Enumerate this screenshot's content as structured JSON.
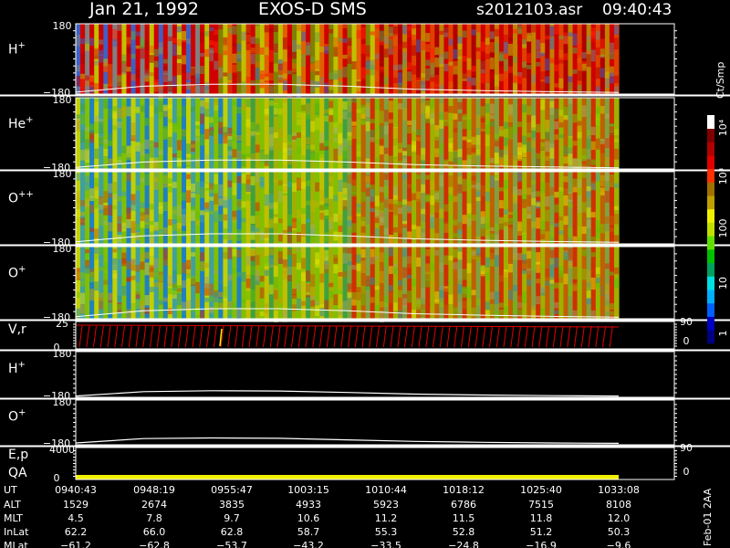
{
  "header": {
    "date": "Jan 21, 1992",
    "instrument": "EXOS-D SMS",
    "file": "s2012103.asr",
    "time": "09:40:43"
  },
  "colorbar": {
    "unit_label": "Ct/Smp",
    "tick_labels": [
      "1",
      "10",
      "100",
      "10³",
      "10⁴"
    ],
    "colors": [
      "#000080",
      "#0000c0",
      "#0060ff",
      "#00b0ff",
      "#00e0e0",
      "#00a060",
      "#00c000",
      "#60e000",
      "#c0e000",
      "#f0f000",
      "#c0a000",
      "#a07000",
      "#ff3000",
      "#e00000",
      "#b00000",
      "#800000",
      "#ffffff"
    ]
  },
  "panels": [
    {
      "id": "h_plus_spec",
      "label": "H",
      "sup": "+",
      "ytop": "180",
      "ybot": "−180"
    },
    {
      "id": "he_plus_spec",
      "label": "He",
      "sup": "+",
      "ytop": "180",
      "ybot": "−180"
    },
    {
      "id": "o_pp_spec",
      "label": "O",
      "sup": "++",
      "ytop": "180",
      "ybot": "−180"
    },
    {
      "id": "o_plus_spec",
      "label": "O",
      "sup": "+",
      "ytop": "180",
      "ybot": "−180"
    },
    {
      "id": "vr",
      "label": "V,r",
      "ytop": "25",
      "ybot": "0",
      "rtop": "90",
      "rbot": "0"
    },
    {
      "id": "h_plus_line",
      "label": "H",
      "sup": "+",
      "ytop": "180",
      "ybot": "−180"
    },
    {
      "id": "o_plus_line",
      "label": "O",
      "sup": "+",
      "ytop": "180",
      "ybot": "−180"
    },
    {
      "id": "ep_qa",
      "label": "E,p",
      "label2": "QA",
      "ytop": "4000",
      "ybot": "0",
      "rtop": "90",
      "rbot": "0"
    }
  ],
  "footer": {
    "row_labels": [
      "UT",
      "ALT",
      "MLT",
      "InLat",
      "MLat"
    ],
    "columns": [
      [
        "0940:43",
        "1529",
        "4.5",
        "62.2",
        "−61.2"
      ],
      [
        "0948:19",
        "2674",
        "7.8",
        "66.0",
        "−62.8"
      ],
      [
        "0955:47",
        "3835",
        "9.7",
        "62.8",
        "−53.7"
      ],
      [
        "1003:15",
        "4933",
        "10.6",
        "58.7",
        "−43.2"
      ],
      [
        "1010:44",
        "5923",
        "11.2",
        "55.3",
        "−33.5"
      ],
      [
        "1018:12",
        "6786",
        "11.5",
        "52.8",
        "−24.8"
      ],
      [
        "1025:40",
        "7515",
        "11.8",
        "51.2",
        "−16.9"
      ],
      [
        "1033:08",
        "8108",
        "12.0",
        "50.3",
        "−9.6"
      ]
    ],
    "stamp": "Feb-01 2AA"
  },
  "chart_data": {
    "type": "heatmap",
    "title": "Jan 21, 1992   EXOS-D SMS",
    "x": [
      "0940:43",
      "0948:19",
      "0955:47",
      "1003:15",
      "1010:44",
      "1018:12",
      "1025:40",
      "1033:08"
    ],
    "ylim": [
      -180,
      180
    ],
    "colorbar_range": [
      1,
      10000
    ],
    "series": [
      {
        "name": "H+",
        "curve": [
          -170,
          -140,
          -130,
          -130,
          -140,
          -155,
          -162,
          -168,
          -172
        ]
      },
      {
        "name": "He+",
        "curve": [
          -172,
          -145,
          -135,
          -135,
          -145,
          -158,
          -165,
          -170,
          -174
        ]
      },
      {
        "name": "O++",
        "curve": [
          -170,
          -140,
          -130,
          -130,
          -140,
          -155,
          -162,
          -168,
          -172
        ]
      },
      {
        "name": "O+",
        "curve": [
          -170,
          -140,
          -130,
          -130,
          -140,
          -155,
          -162,
          -168,
          -172
        ]
      }
    ],
    "line_panels": [
      {
        "name": "H+",
        "values": [
          -170,
          -135,
          -128,
          -130,
          -142,
          -155,
          -162,
          -167,
          -170
        ]
      },
      {
        "name": "O+",
        "values": [
          -165,
          -130,
          -125,
          -128,
          -140,
          -153,
          -160,
          -165,
          -168
        ]
      }
    ]
  }
}
